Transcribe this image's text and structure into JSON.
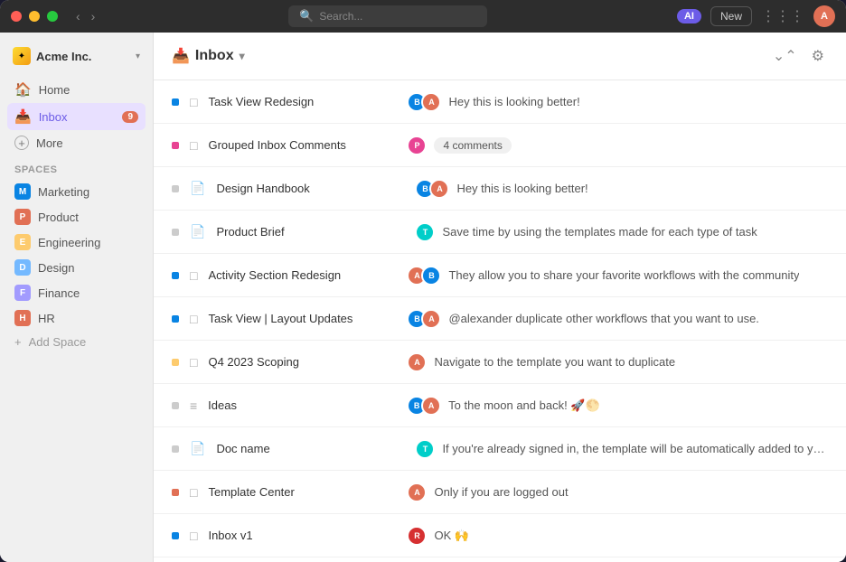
{
  "window": {
    "title": "Acme Inc."
  },
  "titlebar": {
    "search_placeholder": "Search...",
    "ai_label": "AI",
    "new_label": "New"
  },
  "sidebar": {
    "workspace": "Acme Inc.",
    "nav_items": [
      {
        "id": "home",
        "label": "Home",
        "icon": "🏠"
      },
      {
        "id": "inbox",
        "label": "Inbox",
        "icon": "📥",
        "badge": "9",
        "active": true
      },
      {
        "id": "more",
        "label": "More",
        "icon": "+"
      }
    ],
    "spaces_label": "Spaces",
    "spaces": [
      {
        "id": "marketing",
        "label": "Marketing",
        "letter": "M",
        "color": "#0984e3"
      },
      {
        "id": "product",
        "label": "Product",
        "letter": "P",
        "color": "#e17055"
      },
      {
        "id": "engineering",
        "label": "Engineering",
        "letter": "E",
        "color": "#fdcb6e"
      },
      {
        "id": "design",
        "label": "Design",
        "letter": "D",
        "color": "#74b9ff"
      },
      {
        "id": "finance",
        "label": "Finance",
        "letter": "F",
        "color": "#a29bfe"
      },
      {
        "id": "hr",
        "label": "HR",
        "letter": "H",
        "color": "#e17055"
      }
    ],
    "add_space_label": "Add Space"
  },
  "main": {
    "title": "Inbox",
    "title_icon": "📥"
  },
  "inbox_rows": [
    {
      "id": "task-view-redesign",
      "indicator_color": "#0984e3",
      "icon": "□",
      "title": "Task View Redesign",
      "avatars": [
        "av-blue",
        "av-orange"
      ],
      "message": "Hey this is looking better!"
    },
    {
      "id": "grouped-inbox-comments",
      "indicator_color": "#e84393",
      "icon": "□",
      "title": "Grouped Inbox Comments",
      "avatars": [
        "av-pink"
      ],
      "message_badge": "4 comments"
    },
    {
      "id": "design-handbook",
      "indicator_color": "#aaa",
      "icon": "📄",
      "title": "Design Handbook",
      "avatars": [
        "av-blue",
        "av-orange"
      ],
      "message": "Hey this is looking better!"
    },
    {
      "id": "product-brief",
      "indicator_color": "#aaa",
      "icon": "📄",
      "title": "Product Brief",
      "avatars": [
        "av-teal"
      ],
      "message": "Save time by using the templates made for each type of task"
    },
    {
      "id": "activity-section-redesign",
      "indicator_color": "#0984e3",
      "icon": "□",
      "title": "Activity Section Redesign",
      "avatars": [
        "av-orange",
        "av-blue"
      ],
      "message": "They allow you to share your favorite workflows with the community"
    },
    {
      "id": "task-view-layout",
      "indicator_color": "#0984e3",
      "icon": "□",
      "title": "Task View | Layout Updates",
      "avatars": [
        "av-blue",
        "av-orange"
      ],
      "message": "@alexander duplicate other workflows that you want to use."
    },
    {
      "id": "q4-2023-scoping",
      "indicator_color": "#fdcb6e",
      "icon": "□",
      "title": "Q4 2023 Scoping",
      "avatars": [
        "av-orange"
      ],
      "message": "Navigate to the template you want to duplicate"
    },
    {
      "id": "ideas",
      "indicator_color": "#aaa",
      "icon": "≡",
      "title": "Ideas",
      "avatars": [
        "av-blue",
        "av-orange"
      ],
      "message": "To the moon and back! 🚀🌕"
    },
    {
      "id": "doc-name",
      "indicator_color": "#aaa",
      "icon": "📄",
      "title": "Doc name",
      "avatars": [
        "av-teal"
      ],
      "message": "If you're already signed in, the template will be automatically added to your..."
    },
    {
      "id": "template-center",
      "indicator_color": "#e17055",
      "icon": "□",
      "title": "Template Center",
      "avatars": [
        "av-orange"
      ],
      "message": "Only if you are logged out"
    },
    {
      "id": "inbox-v1",
      "indicator_color": "#0984e3",
      "icon": "□",
      "title": "Inbox v1",
      "avatars": [
        "av-red"
      ],
      "message": "OK 🙌"
    }
  ]
}
